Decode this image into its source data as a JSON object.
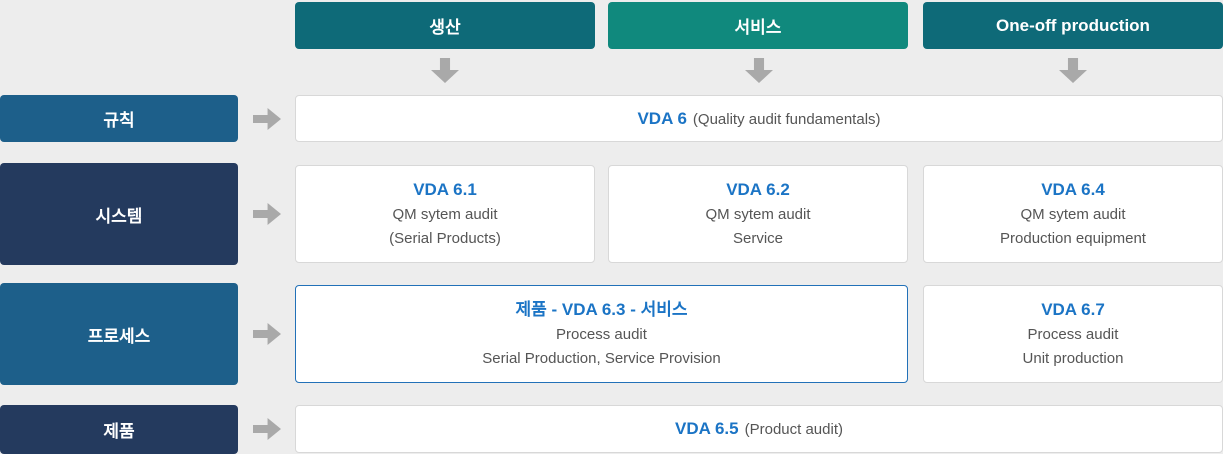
{
  "page": {
    "background": "#ededed"
  },
  "colors": {
    "teal": "#0e6a78",
    "green_teal": "#10897d",
    "blue": "#1d5f8a",
    "navy": "#243a5e",
    "title_blue": "#1b74c5",
    "sub_text": "#555555",
    "cell_border": "#d8d8d8",
    "highlight_border": "#2271b8",
    "arrow_gray": "#a9a9a9"
  },
  "headers": [
    {
      "label": "생산",
      "color": "#0e6a78"
    },
    {
      "label": "서비스",
      "color": "#10897d"
    },
    {
      "label": "One-off production",
      "color": "#0e6a78"
    }
  ],
  "row_labels": [
    {
      "label": "규칙",
      "color": "#1d5f8a"
    },
    {
      "label": "시스템",
      "color": "#243a5e"
    },
    {
      "label": "프로세스",
      "color": "#1d5f8a"
    },
    {
      "label": "제품",
      "color": "#243a5e"
    }
  ],
  "cells": {
    "vda6": {
      "title": "VDA 6",
      "suffix": "(Quality audit fundamentals)"
    },
    "vda61": {
      "title": "VDA 6.1",
      "line1": "QM sytem audit",
      "line2": "(Serial Products)"
    },
    "vda62": {
      "title": "VDA 6.2",
      "line1": "QM sytem audit",
      "line2": "Service"
    },
    "vda64": {
      "title": "VDA 6.4",
      "line1": "QM sytem audit",
      "line2": "Production equipment"
    },
    "vda63": {
      "title": "제품 - VDA 6.3 - 서비스",
      "line1": "Process audit",
      "line2": "Serial Production, Service Provision"
    },
    "vda67": {
      "title": "VDA 6.7",
      "line1": "Process audit",
      "line2": "Unit production"
    },
    "vda65": {
      "title": "VDA 6.5",
      "suffix": "(Product audit)"
    }
  }
}
